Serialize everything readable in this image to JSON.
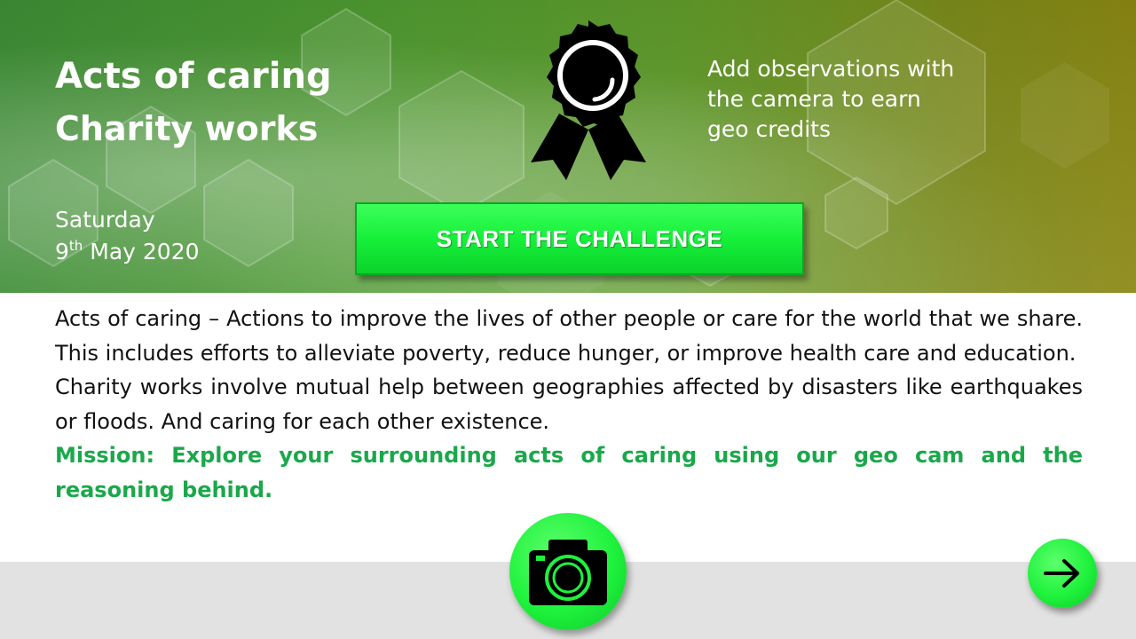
{
  "header": {
    "title": "Acts of caring",
    "subtitle": "Charity works",
    "date_day": "Saturday",
    "date_number": "9",
    "date_suffix": "th",
    "date_rest": "May 2020",
    "hint": "Add observations with the camera to earn geo credits",
    "badge_icon": "award-ribbon-icon"
  },
  "start_button": {
    "label": "START THE CHALLENGE"
  },
  "description": {
    "paragraph1": "Acts of caring – Actions to improve the lives of other people or care for the world that we share. This includes efforts to alleviate poverty, reduce hunger, or improve health care and education.",
    "paragraph2": "Charity works involve mutual help between geographies affected by disasters like earthquakes or floods. And caring for each other existence.",
    "mission": "Mission: Explore your surrounding acts of caring using our geo cam and the reasoning behind."
  },
  "footer": {
    "camera_icon": "camera-icon",
    "next_icon": "arrow-right-icon"
  },
  "colors": {
    "accent_green": "#1ef23c",
    "mission_text": "#1aa84a",
    "footer_bg": "#e2e2e2"
  }
}
